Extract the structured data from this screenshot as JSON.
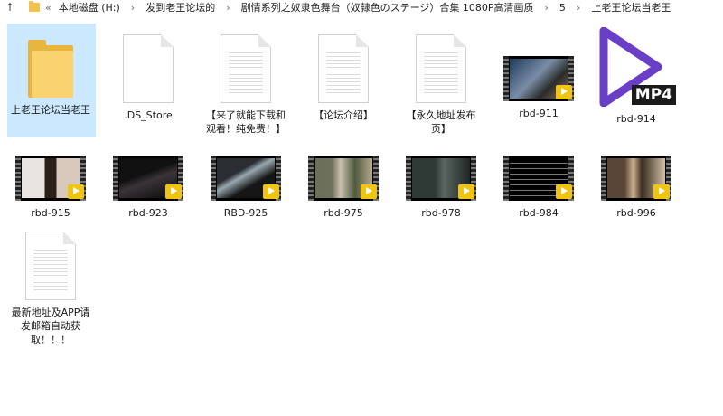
{
  "address": {
    "crumbs": [
      "本地磁盘 (H:)",
      "发到老王论坛的",
      "剧情系列之奴隶色舞台（奴隷色のステージ）合集 1080P高清画质",
      "5",
      "上老王论坛当老王"
    ]
  },
  "items": [
    {
      "label": "上老王论坛当老王",
      "type": "folder"
    },
    {
      "label": ".DS_Store",
      "type": "blank-doc"
    },
    {
      "label": "【来了就能下载和观看！纯免费！】",
      "type": "doc"
    },
    {
      "label": "【论坛介绍】",
      "type": "doc"
    },
    {
      "label": "【永久地址发布页】",
      "type": "doc"
    },
    {
      "label": "rbd-911",
      "type": "video"
    },
    {
      "label": "rbd-914",
      "type": "mp4"
    },
    {
      "label": "rbd-915",
      "type": "video"
    },
    {
      "label": "rbd-923",
      "type": "video"
    },
    {
      "label": "RBD-925",
      "type": "video"
    },
    {
      "label": "rbd-975",
      "type": "video"
    },
    {
      "label": "rbd-978",
      "type": "video"
    },
    {
      "label": "rbd-984",
      "type": "video"
    },
    {
      "label": "rbd-996",
      "type": "video"
    },
    {
      "label": "最新地址及APP请发邮箱自动获取！！！",
      "type": "doc"
    }
  ],
  "mp4_badge": "MP4",
  "colors": {
    "folder": "#f9d370",
    "selection": "#cce8ff",
    "player_badge": "#f1c40f",
    "mp4_accent": "#6a3fc8"
  }
}
